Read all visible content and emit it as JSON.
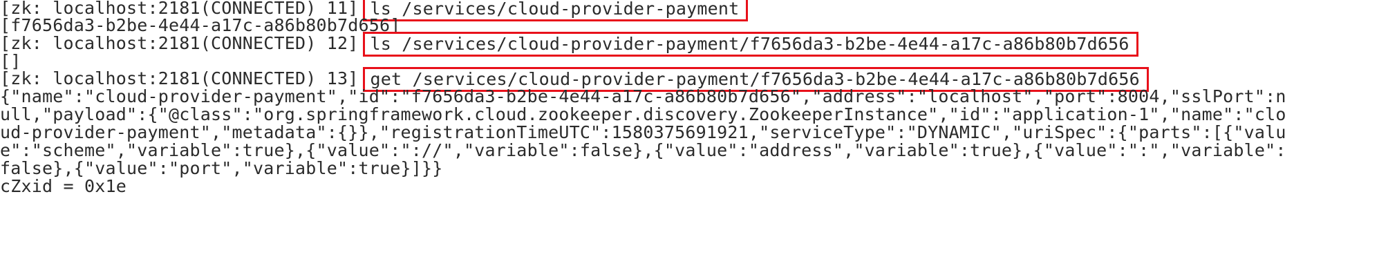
{
  "terminal": {
    "lines": [
      {
        "type": "prompt",
        "prompt": "[zk: localhost:2181(CONNECTED) 11]",
        "command": "ls /services/cloud-provider-payment"
      },
      {
        "type": "output",
        "text": "[f7656da3-b2be-4e44-a17c-a86b80b7d656]"
      },
      {
        "type": "prompt",
        "prompt": "[zk: localhost:2181(CONNECTED) 12]",
        "command": "ls /services/cloud-provider-payment/f7656da3-b2be-4e44-a17c-a86b80b7d656"
      },
      {
        "type": "output",
        "text": "[]"
      },
      {
        "type": "prompt",
        "prompt": "[zk: localhost:2181(CONNECTED) 13]",
        "command": "get /services/cloud-provider-payment/f7656da3-b2be-4e44-a17c-a86b80b7d656"
      },
      {
        "type": "output",
        "text": "{\"name\":\"cloud-provider-payment\",\"id\":\"f7656da3-b2be-4e44-a17c-a86b80b7d656\",\"address\":\"localhost\",\"port\":8004,\"sslPort\":n"
      },
      {
        "type": "output",
        "text": "ull,\"payload\":{\"@class\":\"org.springframework.cloud.zookeeper.discovery.ZookeeperInstance\",\"id\":\"application-1\",\"name\":\"clo"
      },
      {
        "type": "output",
        "text": "ud-provider-payment\",\"metadata\":{}},\"registrationTimeUTC\":1580375691921,\"serviceType\":\"DYNAMIC\",\"uriSpec\":{\"parts\":[{\"valu"
      },
      {
        "type": "output",
        "text": "e\":\"scheme\",\"variable\":true},{\"value\":\"://\",\"variable\":false},{\"value\":\"address\",\"variable\":true},{\"value\":\":\",\"variable\":"
      },
      {
        "type": "output",
        "text": "false},{\"value\":\"port\",\"variable\":true}]}}"
      },
      {
        "type": "output",
        "text": "cZxid = 0x1e"
      }
    ]
  },
  "colors": {
    "highlight_border": "#e8101a",
    "text": "#2b2b2b",
    "background": "#ffffff"
  }
}
